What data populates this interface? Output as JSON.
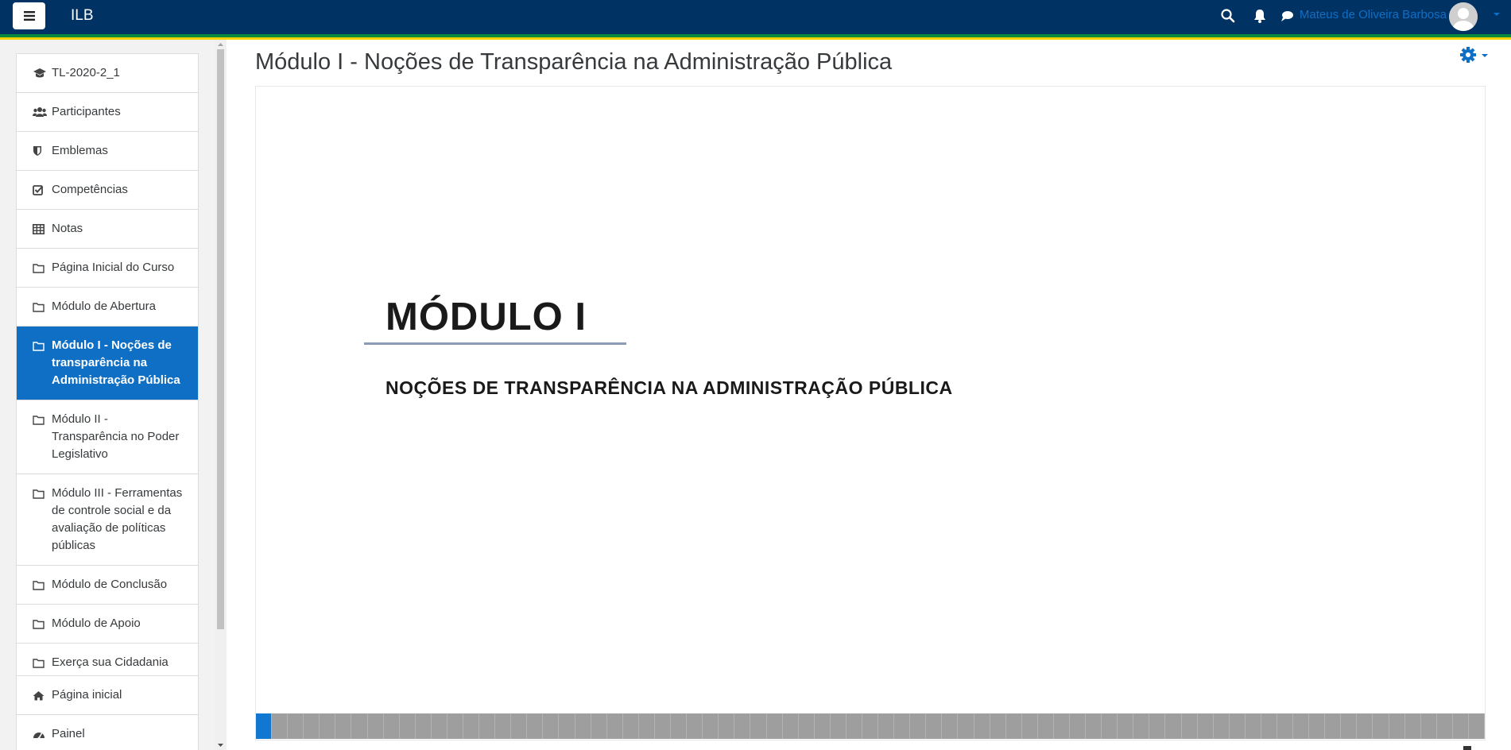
{
  "navbar": {
    "brand": "ILB",
    "user_name": "Mateus de Oliveira Barbosa",
    "icons": [
      "menu-icon",
      "search-icon",
      "bell-icon",
      "chat-icon",
      "chevron-down-icon"
    ],
    "bg_color": "#003264"
  },
  "drawer": {
    "course_items": [
      {
        "icon": "graduation-cap-icon",
        "label": "TL-2020-2_1"
      },
      {
        "icon": "users-icon",
        "label": "Participantes"
      },
      {
        "icon": "shield-icon",
        "label": "Emblemas"
      },
      {
        "icon": "checkbox-icon",
        "label": "Competências"
      },
      {
        "icon": "table-icon",
        "label": "Notas"
      },
      {
        "icon": "folder-icon",
        "label": "Página Inicial do Curso"
      },
      {
        "icon": "folder-icon",
        "label": "Módulo de Abertura"
      },
      {
        "icon": "folder-icon",
        "label": "Módulo I - Noções de transparência na Administração Pública",
        "active": true
      },
      {
        "icon": "folder-icon",
        "label": "Módulo II - Transparência no Poder Legislativo"
      },
      {
        "icon": "folder-icon",
        "label": "Módulo III - Ferramentas de controle social e da avaliação de políticas públicas"
      },
      {
        "icon": "folder-icon",
        "label": "Módulo de Conclusão"
      },
      {
        "icon": "folder-icon",
        "label": "Módulo de Apoio"
      },
      {
        "icon": "folder-icon",
        "label": "Exerça sua Cidadania"
      }
    ],
    "site_items": [
      {
        "icon": "home-icon",
        "label": "Página inicial"
      },
      {
        "icon": "dashboard-icon",
        "label": "Painel"
      }
    ],
    "active_color": "#0f6fc5"
  },
  "main": {
    "page_title": "Módulo I - Noções de Transparência na Administração Pública",
    "settings_icon": "gear-icon",
    "slide": {
      "title": "MÓDULO I",
      "subtitle": "NOÇÕES DE TRANSPARÊNCIA NA ADMINISTRAÇÃO PÚBLICA"
    },
    "progress": {
      "total_segments": 77,
      "current_segment": 1
    }
  }
}
